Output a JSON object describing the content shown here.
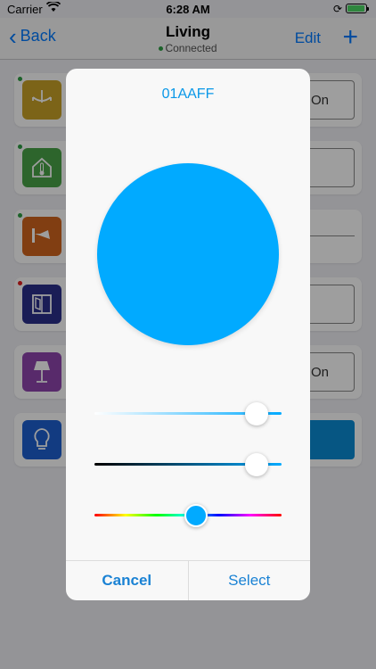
{
  "status_bar": {
    "carrier": "Carrier",
    "time": "6:28 AM"
  },
  "nav": {
    "back_label": "Back",
    "title": "Living",
    "subtitle": "Connected",
    "edit_label": "Edit",
    "add_label": "+"
  },
  "devices": [
    {
      "icon": "chandelier-icon",
      "color": "#c9a227",
      "status_color": "#2e9e44",
      "control_text": "On"
    },
    {
      "icon": "thermostat-icon",
      "color": "#4aa448",
      "status_color": "#2e9e44",
      "control_text": ""
    },
    {
      "icon": "wall-lamp-icon",
      "color": "#d0641e",
      "status_color": "#2e9e44",
      "control_text": ""
    },
    {
      "icon": "window-icon",
      "color": "#2b2f8c",
      "status_color": "#e02020",
      "control_text": ""
    },
    {
      "icon": "floor-lamp-icon",
      "color": "#8e44ad",
      "status_color": "",
      "control_text": "On"
    },
    {
      "icon": "bulb-icon",
      "color": "#1e5fd0",
      "status_color": "",
      "control_text": ""
    }
  ],
  "picker": {
    "hex": "01AAFF",
    "color": "#01aaff",
    "saturation": 0.92,
    "brightness": 0.92,
    "hue": 0.55,
    "cancel_label": "Cancel",
    "select_label": "Select"
  }
}
